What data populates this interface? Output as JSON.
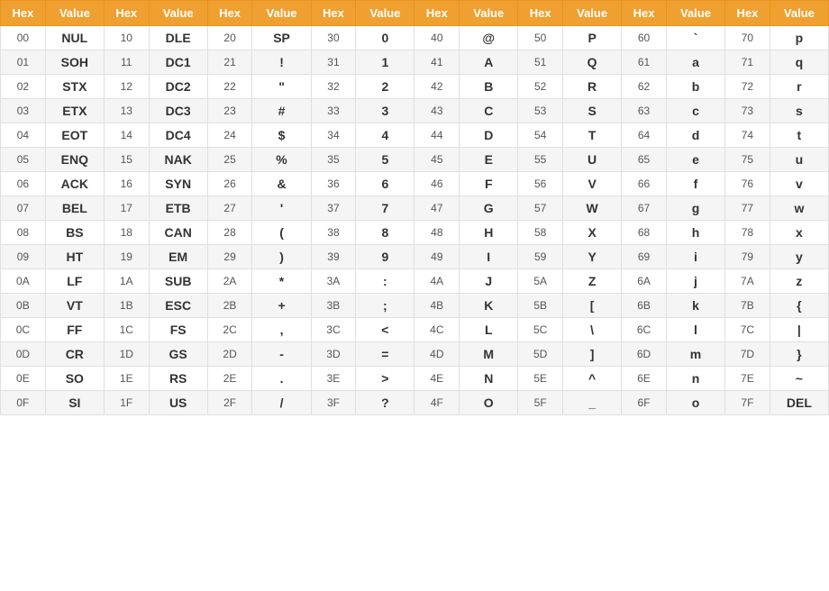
{
  "table": {
    "headers": [
      "Hex",
      "Value",
      "Hex",
      "Value",
      "Hex",
      "Value",
      "Hex",
      "Value",
      "Hex",
      "Value",
      "Hex",
      "Value",
      "Hex",
      "Value",
      "Hex",
      "Value"
    ],
    "rows": [
      [
        "00",
        "NUL",
        "10",
        "DLE",
        "20",
        "SP",
        "30",
        "0",
        "40",
        "@",
        "50",
        "P",
        "60",
        "`",
        "70",
        "p"
      ],
      [
        "01",
        "SOH",
        "11",
        "DC1",
        "21",
        "!",
        "31",
        "1",
        "41",
        "A",
        "51",
        "Q",
        "61",
        "a",
        "71",
        "q"
      ],
      [
        "02",
        "STX",
        "12",
        "DC2",
        "22",
        "\"",
        "32",
        "2",
        "42",
        "B",
        "52",
        "R",
        "62",
        "b",
        "72",
        "r"
      ],
      [
        "03",
        "ETX",
        "13",
        "DC3",
        "23",
        "#",
        "33",
        "3",
        "43",
        "C",
        "53",
        "S",
        "63",
        "c",
        "73",
        "s"
      ],
      [
        "04",
        "EOT",
        "14",
        "DC4",
        "24",
        "$",
        "34",
        "4",
        "44",
        "D",
        "54",
        "T",
        "64",
        "d",
        "74",
        "t"
      ],
      [
        "05",
        "ENQ",
        "15",
        "NAK",
        "25",
        "%",
        "35",
        "5",
        "45",
        "E",
        "55",
        "U",
        "65",
        "e",
        "75",
        "u"
      ],
      [
        "06",
        "ACK",
        "16",
        "SYN",
        "26",
        "&",
        "36",
        "6",
        "46",
        "F",
        "56",
        "V",
        "66",
        "f",
        "76",
        "v"
      ],
      [
        "07",
        "BEL",
        "17",
        "ETB",
        "27",
        "'",
        "37",
        "7",
        "47",
        "G",
        "57",
        "W",
        "67",
        "g",
        "77",
        "w"
      ],
      [
        "08",
        "BS",
        "18",
        "CAN",
        "28",
        "(",
        "38",
        "8",
        "48",
        "H",
        "58",
        "X",
        "68",
        "h",
        "78",
        "x"
      ],
      [
        "09",
        "HT",
        "19",
        "EM",
        "29",
        ")",
        "39",
        "9",
        "49",
        "I",
        "59",
        "Y",
        "69",
        "i",
        "79",
        "y"
      ],
      [
        "0A",
        "LF",
        "1A",
        "SUB",
        "2A",
        "*",
        "3A",
        ":",
        "4A",
        "J",
        "5A",
        "Z",
        "6A",
        "j",
        "7A",
        "z"
      ],
      [
        "0B",
        "VT",
        "1B",
        "ESC",
        "2B",
        "+",
        "3B",
        ";",
        "4B",
        "K",
        "5B",
        "[",
        "6B",
        "k",
        "7B",
        "{"
      ],
      [
        "0C",
        "FF",
        "1C",
        "FS",
        "2C",
        ",",
        "3C",
        "<",
        "4C",
        "L",
        "5C",
        "\\",
        "6C",
        "l",
        "7C",
        "|"
      ],
      [
        "0D",
        "CR",
        "1D",
        "GS",
        "2D",
        "-",
        "3D",
        "=",
        "4D",
        "M",
        "5D",
        "]",
        "6D",
        "m",
        "7D",
        "}"
      ],
      [
        "0E",
        "SO",
        "1E",
        "RS",
        "2E",
        ".",
        "3E",
        ">",
        "4E",
        "N",
        "5E",
        "^",
        "6E",
        "n",
        "7E",
        "~"
      ],
      [
        "0F",
        "SI",
        "1F",
        "US",
        "2F",
        "/",
        "3F",
        "?",
        "4F",
        "O",
        "5F",
        "_",
        "6F",
        "o",
        "7F",
        "DEL"
      ]
    ]
  }
}
